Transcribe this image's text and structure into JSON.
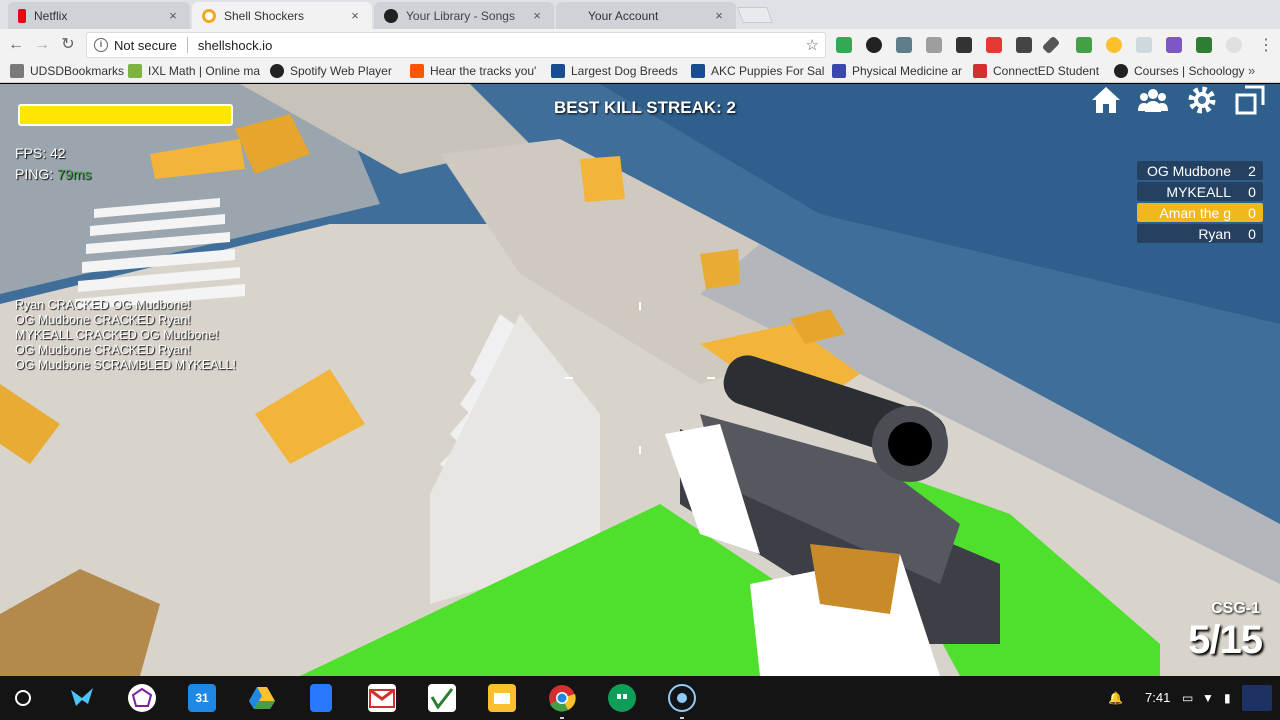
{
  "browser": {
    "tabs": [
      {
        "label": "Netflix",
        "favicon_color": "#e50914",
        "active": false
      },
      {
        "label": "Shell Shockers",
        "favicon_color": "#f5a623",
        "active": true
      },
      {
        "label": "Your Library - Songs",
        "favicon_color": "#222222",
        "active": false
      },
      {
        "label": "Your Account",
        "favicon_color": "#cfd2d6",
        "active": false
      }
    ],
    "close_glyph": "×",
    "omnibox": {
      "security": "Not secure",
      "url": "shellshock.io"
    },
    "bookmarks": [
      {
        "label": "UDSDBookmarks",
        "icon": "folder-icon"
      },
      {
        "label": "IXL Math | Online ma",
        "icon": "ixl-icon"
      },
      {
        "label": "Spotify Web Player",
        "icon": "spotify-icon"
      },
      {
        "label": "Hear the tracks you'",
        "icon": "soundcloud-icon"
      },
      {
        "label": "Largest Dog Breeds",
        "icon": "akc-icon"
      },
      {
        "label": "AKC Puppies For Sal",
        "icon": "akc-icon"
      },
      {
        "label": "Physical Medicine ar",
        "icon": "pm-icon"
      },
      {
        "label": "ConnectED Student",
        "icon": "connected-icon"
      },
      {
        "label": "Courses | Schoology",
        "icon": "schoology-icon"
      }
    ]
  },
  "game": {
    "hud": {
      "health_percent": 100,
      "fps_label": "FPS: 42",
      "ping_label": "PING:",
      "ping_value": "79ms",
      "best_kill_streak": "BEST KILL STREAK: 2"
    },
    "killfeed": [
      "Ryan CRACKED OG Mudbone!",
      "OG Mudbone CRACKED Ryan!",
      "MYKEALL CRACKED OG Mudbone!",
      "OG Mudbone CRACKED Ryan!",
      "OG Mudbone SCRAMBLED MYKEALL!"
    ],
    "scoreboard": [
      {
        "name": "OG Mudbone",
        "score": "2",
        "is_self": false
      },
      {
        "name": "MYKEALL",
        "score": "0",
        "is_self": false
      },
      {
        "name": "Aman the g",
        "score": "0",
        "is_self": true
      },
      {
        "name": "Ryan",
        "score": "0",
        "is_self": false
      }
    ],
    "weapon": {
      "name": "CSG-1",
      "ammo": "5/15"
    },
    "colors": {
      "health": "#ffe600",
      "self_highlight": "#f0b81c",
      "ping_good": "#4caf50",
      "terrain_green": "#4ee02c",
      "crate_yellow": "#f2b53a",
      "sky": "#3f6e9a"
    }
  },
  "shelf": {
    "apps": [
      "bird-icon",
      "screencastify-icon",
      "calendar-icon",
      "drive-icon",
      "docs-icon",
      "gmail-icon",
      "classroom-icon",
      "slides-icon",
      "chrome-icon",
      "hangouts-icon",
      "screen-recorder-icon"
    ],
    "calendar_day": "31",
    "time": "7:41"
  }
}
